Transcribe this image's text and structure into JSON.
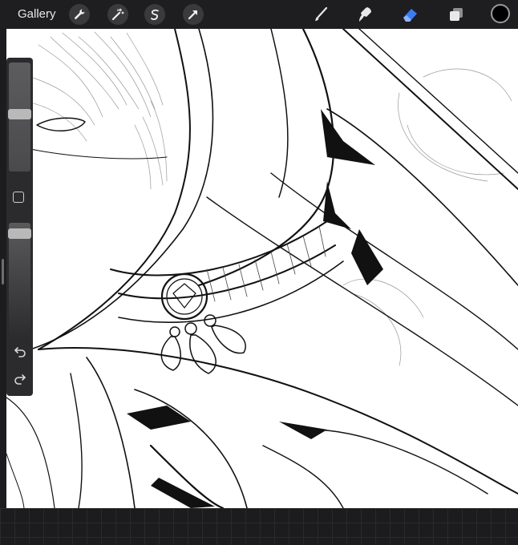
{
  "topbar": {
    "gallery_label": "Gallery",
    "action_buttons": [
      "wrench-icon",
      "magic-wand-icon",
      "selection-icon",
      "transform-arrow-icon"
    ],
    "tools": [
      "brush-icon",
      "smudge-icon",
      "eraser-icon",
      "layers-icon"
    ],
    "active_tool": "eraser-icon",
    "active_color": "#000000",
    "accent_color": "#3b7cf5"
  },
  "sidebar": {
    "brush_size_level": 0.53,
    "brush_opacity_level": 0.05,
    "controls": [
      "modify-button",
      "undo-icon",
      "redo-icon"
    ]
  },
  "canvas": {
    "background": "#ffffff"
  }
}
